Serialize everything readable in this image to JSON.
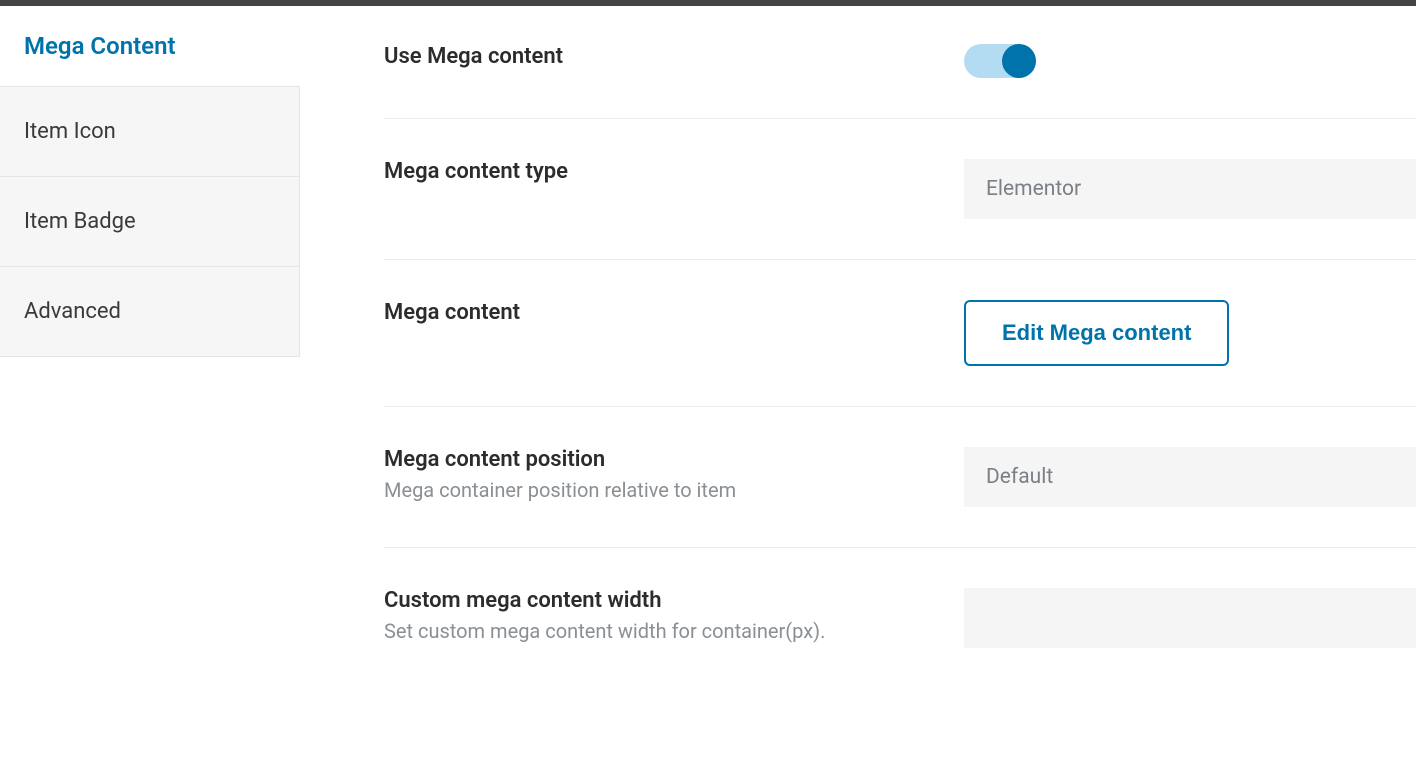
{
  "sidebar": {
    "active": "Mega Content",
    "items": [
      "Item Icon",
      "Item Badge",
      "Advanced"
    ]
  },
  "rows": {
    "use_mega": {
      "label": "Use Mega content",
      "enabled": true
    },
    "content_type": {
      "label": "Mega content type",
      "value": "Elementor"
    },
    "mega_content": {
      "label": "Mega content",
      "button": "Edit Mega content"
    },
    "position": {
      "label": "Mega content position",
      "desc": "Mega container position relative to item",
      "value": "Default"
    },
    "custom_width": {
      "label": "Custom mega content width",
      "desc": "Set custom mega content width for container(px).",
      "value": ""
    }
  }
}
